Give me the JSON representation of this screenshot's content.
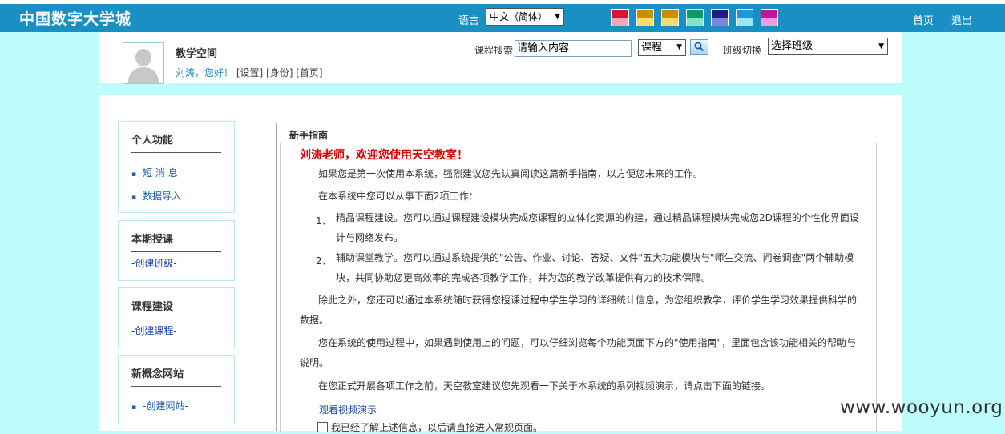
{
  "topbar": {
    "logo": "中国数字大学城",
    "language_label": "语言",
    "language_value": "中文（简体）",
    "nav_home": "首页",
    "nav_exit": "退出",
    "theme_swatches": [
      {
        "top": "#d8103a",
        "bottom": "#f2a7b6"
      },
      {
        "top": "#c79000",
        "bottom": "#f5dc6c"
      },
      {
        "top": "#c79000",
        "bottom": "#f5dc6c"
      },
      {
        "top": "#089c6c",
        "bottom": "#7fe6c2"
      },
      {
        "top": "#1a1f8a",
        "bottom": "#7a86d8"
      },
      {
        "top": "#1a9ad0",
        "bottom": "#9ee3f8"
      },
      {
        "top": "#c0139e",
        "bottom": "#f59ad8"
      }
    ]
  },
  "header": {
    "space_title": "教学空间",
    "greeting": "刘涛，您好！",
    "link_settings": "[设置]",
    "link_role": "[身份]",
    "link_home": "[首页]",
    "search_label": "课程搜索",
    "search_value": "请输入内容",
    "search_type": "课程",
    "class_label": "班级切换",
    "class_value": "选择班级"
  },
  "sidebar": {
    "personal": {
      "title": "个人功能",
      "items": [
        "短 消 息",
        "数据导入"
      ]
    },
    "current": {
      "title": "本期授课",
      "link": "-创建班级-"
    },
    "course": {
      "title": "课程建设",
      "link": "-创建课程-"
    },
    "site": {
      "title": "新概念网站",
      "link": "-创建网站-"
    }
  },
  "guide": {
    "title": "新手指南",
    "welcome": "刘涛老师，欢迎您使用天空教室！",
    "intro": "如果您是第一次使用本系统，强烈建议您先认真阅读这篇新手指南，以方便您未来的工作。",
    "tasks_intro": "在本系统中您可以从事下面2项工作：",
    "item1_num": "1、",
    "item1_line1": "精品课程建设。您可以通过课程建设模块完成您课程的立体化资源的构建，通过精品课程模块完成您2D课程的个性化界面设",
    "item1_line2": "计与网络发布。",
    "item2_num": "2、",
    "item2_line1": "辅助课堂教学。您可以通过系统提供的\"公告、作业、讨论、答疑、文件\"五大功能模块与\"师生交流、问卷调查\"两个辅助模",
    "item2_line2": "块，共同协助您更高效率的完成各项教学工作，并为您的教学改革提供有力的技术保障。",
    "extra_line1": "除此之外，您还可以通过本系统随时获得您授课过程中学生学习的详细统计信息，为您组织教学，评价学生学习效果提供科学的",
    "extra_line2": "数据。",
    "help_line1": "您在系统的使用过程中，如果遇到使用上的问题，可以仔细浏览每个功能页面下方的\"使用指南\"，里面包含该功能相关的帮助与",
    "help_line2": "说明。",
    "video_intro": "在您正式开展各项工作之前，天空教室建议您先观看一下关于本系统的系列视频演示，请点击下面的链接。",
    "video_link": "观看视频演示",
    "agree_text": "我已经了解上述信息，以后请直接进入常规页面。"
  },
  "watermark": "www.wooyun.org"
}
